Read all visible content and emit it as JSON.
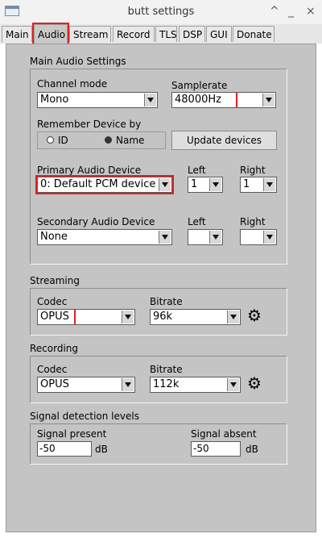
{
  "window": {
    "title": "butt settings",
    "controls": [
      "^",
      "_",
      "×"
    ]
  },
  "tabs": [
    "Main",
    "Audio",
    "Stream",
    "Record",
    "TLS",
    "DSP",
    "GUI",
    "Donate"
  ],
  "active_tab": "Audio",
  "main_audio": {
    "title": "Main Audio Settings",
    "channel_mode_label": "Channel mode",
    "channel_mode_value": "Mono",
    "samplerate_label": "Samplerate",
    "samplerate_value": "48000Hz",
    "remember_label": "Remember Device by",
    "radio_id": "ID",
    "radio_name": "Name",
    "radio_selected": "Name",
    "update_devices_label": "Update devices",
    "primary_label": "Primary Audio Device",
    "primary_value": "0: Default PCM device",
    "primary_left_label": "Left",
    "primary_left_value": "1",
    "primary_right_label": "Right",
    "primary_right_value": "1",
    "secondary_label": "Secondary Audio Device",
    "secondary_value": "None",
    "secondary_left_label": "Left",
    "secondary_left_value": "",
    "secondary_right_label": "Right",
    "secondary_right_value": ""
  },
  "streaming": {
    "title": "Streaming",
    "codec_label": "Codec",
    "codec_value": "OPUS",
    "bitrate_label": "Bitrate",
    "bitrate_value": "96k"
  },
  "recording": {
    "title": "Recording",
    "codec_label": "Codec",
    "codec_value": "OPUS",
    "bitrate_label": "Bitrate",
    "bitrate_value": "112k"
  },
  "signal": {
    "title": "Signal detection levels",
    "present_label": "Signal present",
    "present_value": "-50",
    "present_unit": "dB",
    "absent_label": "Signal absent",
    "absent_value": "-50",
    "absent_unit": "dB"
  }
}
